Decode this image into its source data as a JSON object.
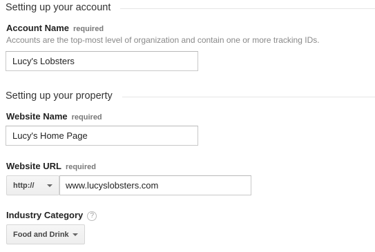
{
  "account_section": {
    "title": "Setting up your account",
    "account_name": {
      "label": "Account Name",
      "required_text": "required",
      "hint": "Accounts are the top-most level of organization and contain one or more tracking IDs.",
      "value": "Lucy's Lobsters"
    }
  },
  "property_section": {
    "title": "Setting up your property",
    "website_name": {
      "label": "Website Name",
      "required_text": "required",
      "value": "Lucy's Home Page"
    },
    "website_url": {
      "label": "Website URL",
      "required_text": "required",
      "protocol": "http://",
      "value": "www.lucyslobsters.com"
    },
    "industry_category": {
      "label": "Industry Category",
      "help_glyph": "?",
      "selected": "Food and Drink"
    }
  }
}
